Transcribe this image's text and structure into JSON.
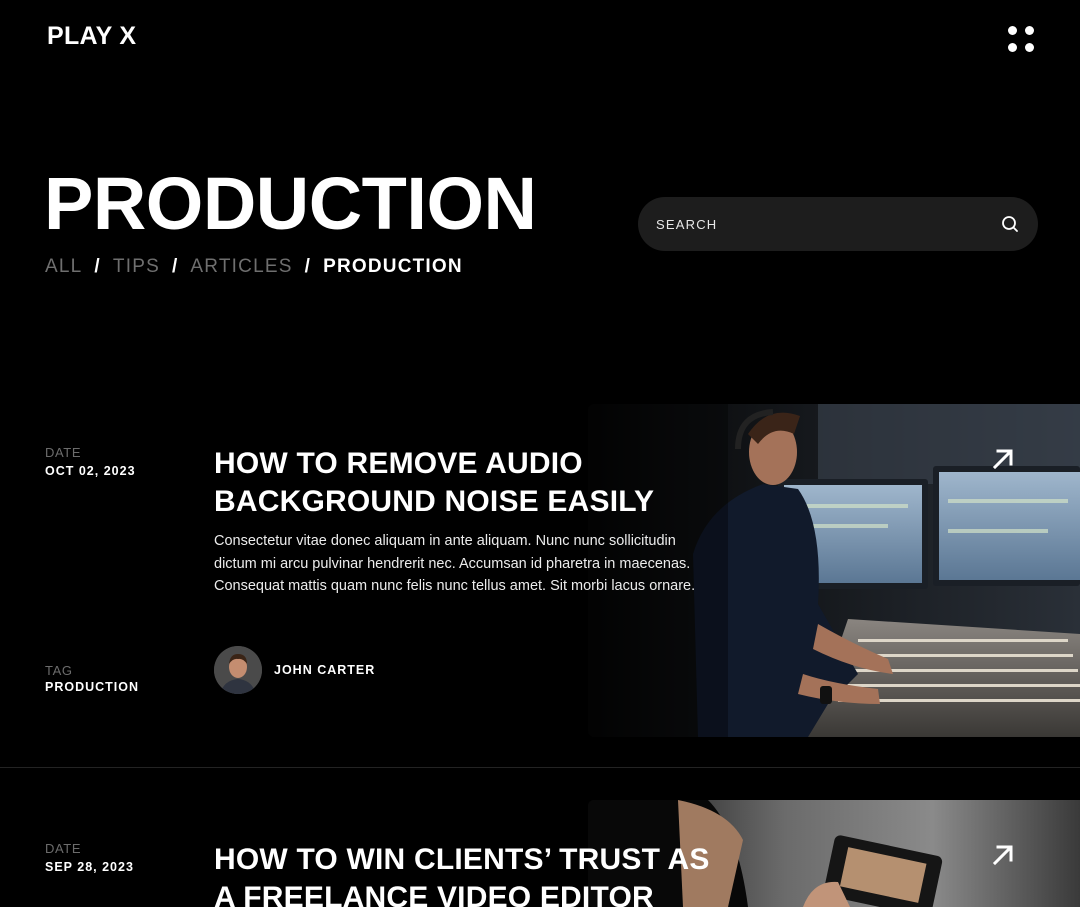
{
  "header": {
    "logo": "PLAY X",
    "menu_icon": "grid-dots-icon"
  },
  "hero": {
    "title": "PRODUCTION",
    "breadcrumb": [
      {
        "label": "ALL",
        "active": false
      },
      {
        "label": "TIPS",
        "active": false
      },
      {
        "label": "ARTICLES",
        "active": false
      },
      {
        "label": "PRODUCTION",
        "active": true
      }
    ],
    "separator": "/"
  },
  "search": {
    "placeholder": "SEARCH",
    "icon": "search-icon"
  },
  "posts": [
    {
      "date_label": "DATE",
      "date": "OCT 02, 2023",
      "title": "HOW TO REMOVE AUDIO BACKGROUND NOISE EASILY",
      "excerpt": "Consectetur vitae donec aliquam in ante aliquam. Nunc nunc sollicitudin dictum mi arcu pulvinar hendrerit nec. Accumsan id pharetra in maecenas. Consequat mattis quam nunc felis nunc tellus amet. Sit morbi lacus ornare.",
      "tag_label": "TAG",
      "tag": "PRODUCTION",
      "author": "JOHN CARTER",
      "image": "audio-engineer-at-mixing-console",
      "link_icon": "arrow-up-right-icon"
    },
    {
      "date_label": "DATE",
      "date": "SEP 28, 2023",
      "title": "HOW TO WIN CLIENTS’ TRUST AS A FREELANCE VIDEO EDITOR",
      "image": "person-holding-camera-monitor",
      "link_icon": "arrow-up-right-icon"
    }
  ],
  "colors": {
    "background": "#000000",
    "search_bg": "#1d1d1d",
    "muted_text": "#6f6f6f"
  }
}
